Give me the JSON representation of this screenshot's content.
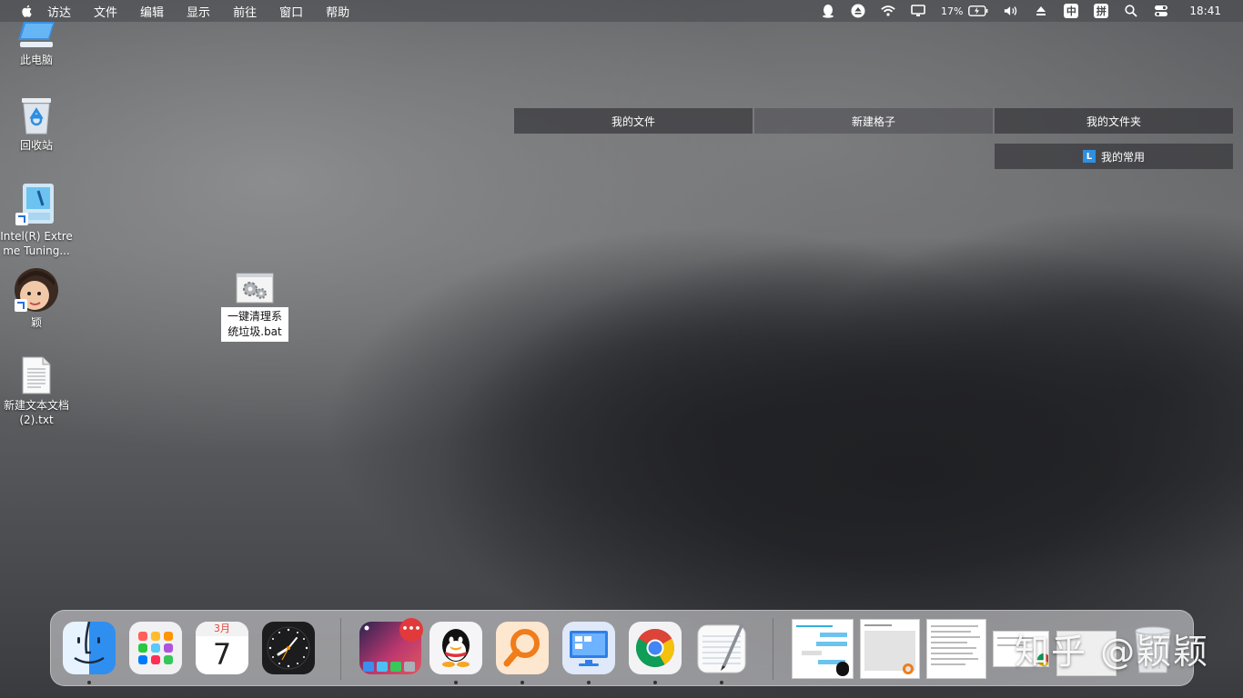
{
  "menubar": {
    "items": [
      "访达",
      "文件",
      "编辑",
      "显示",
      "前往",
      "窗口",
      "帮助"
    ],
    "tray": {
      "battery_percent": "17%",
      "ime_zh": "中",
      "ime_pinyin": "拼",
      "clock": "18:41"
    }
  },
  "desktop": {
    "icons": [
      {
        "label": "此电脑"
      },
      {
        "label": "回收站"
      },
      {
        "label": "Intel(R) Extreme Tuning..."
      },
      {
        "label": "颖"
      },
      {
        "label": "新建文本文档 (2).txt"
      },
      {
        "label": "一键清理系统垃圾.bat"
      }
    ]
  },
  "fences": {
    "bar1": "我的文件",
    "bar2": "新建格子",
    "bar3": "我的文件夹",
    "sub": "我的常用",
    "sub_icon_letter": "L"
  },
  "dock": {
    "calendar_month": "3月",
    "calendar_day": "7",
    "badge": "•••"
  },
  "watermark": "知乎 @颖颖"
}
